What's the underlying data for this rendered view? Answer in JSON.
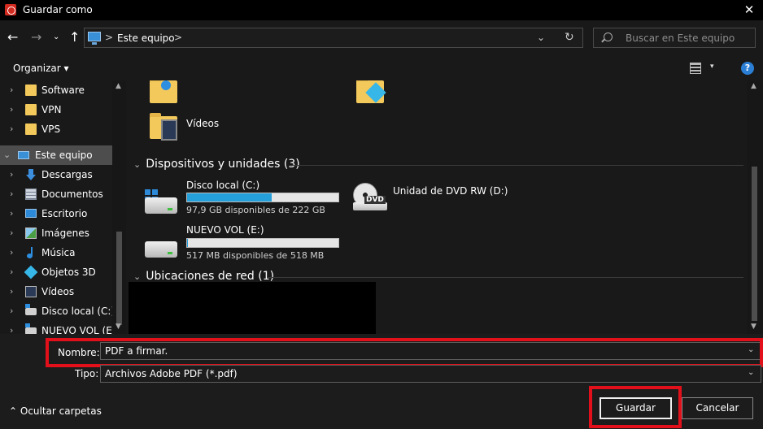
{
  "window": {
    "title": "Guardar como",
    "close_glyph": "✕",
    "app_icon": "acrobat-icon",
    "brand_color": "#d32a20"
  },
  "nav": {
    "back_glyph": "←",
    "forward_glyph": "→",
    "recent_glyph": "⌄",
    "up_glyph": "↑",
    "address": {
      "separator": ">",
      "location": "Este equipo",
      "dropdown_glyph": "⌄",
      "refresh_glyph": "↻"
    },
    "search": {
      "placeholder": "Buscar en Este equipo"
    }
  },
  "toolbar": {
    "organize_label": "Organizar ▾",
    "view_chevron": "▾",
    "help_glyph": "?"
  },
  "sidebar": {
    "items": [
      {
        "label": "Software",
        "icon": "folder-icon",
        "chevron": "›"
      },
      {
        "label": "VPN",
        "icon": "folder-icon",
        "chevron": "›"
      },
      {
        "label": "VPS",
        "icon": "folder-icon",
        "chevron": "›"
      },
      {
        "label": "Este equipo",
        "icon": "computer-icon",
        "chevron": "⌄",
        "selected": true
      },
      {
        "label": "Descargas",
        "icon": "download-icon",
        "chevron": "›"
      },
      {
        "label": "Documentos",
        "icon": "documents-icon",
        "chevron": "›"
      },
      {
        "label": "Escritorio",
        "icon": "desktop-icon",
        "chevron": "›"
      },
      {
        "label": "Imágenes",
        "icon": "images-icon",
        "chevron": "›"
      },
      {
        "label": "Música",
        "icon": "music-icon",
        "chevron": "›"
      },
      {
        "label": "Objetos 3D",
        "icon": "objects-3d-icon",
        "chevron": "›"
      },
      {
        "label": "Vídeos",
        "icon": "videos-icon",
        "chevron": "›"
      },
      {
        "label": "Disco local (C:)",
        "icon": "drive-icon",
        "chevron": "›"
      },
      {
        "label": "NUEVO VOL (E:)",
        "icon": "drive-icon",
        "chevron": "›"
      }
    ],
    "scroll_up": "▲",
    "scroll_down": "▼"
  },
  "content": {
    "folders": {
      "videos_label": "Vídeos"
    },
    "devices_header": "Dispositivos y unidades (3)",
    "network_header": "Ubicaciones de red (1)",
    "group_chevron": "⌄",
    "drives": [
      {
        "name": "Disco local (C:)",
        "free_text": "97,9 GB disponibles de 222 GB",
        "used_fraction": 0.559,
        "icon": "windows-drive-icon"
      },
      {
        "name": "NUEVO VOL (E:)",
        "free_text": "517 MB disponibles de 518 MB",
        "used_fraction": 0.002,
        "icon": "drive-icon"
      }
    ],
    "dvd": {
      "name": "Unidad de DVD RW (D:)",
      "badge": "DVD",
      "icon": "dvd-drive-icon"
    },
    "scroll_up": "▲",
    "scroll_down": "▼",
    "bar_color": "#26a0da"
  },
  "footer": {
    "name_label": "Nombre:",
    "name_value": "PDF a firmar.",
    "type_label": "Tipo:",
    "type_value": "Archivos Adobe PDF (*.pdf)",
    "dropdown_glyph": "⌄",
    "hide_folders_label": "⌃  Ocultar carpetas",
    "save_label": "Guardar",
    "cancel_label": "Cancelar",
    "highlight_color": "#e2101a"
  }
}
